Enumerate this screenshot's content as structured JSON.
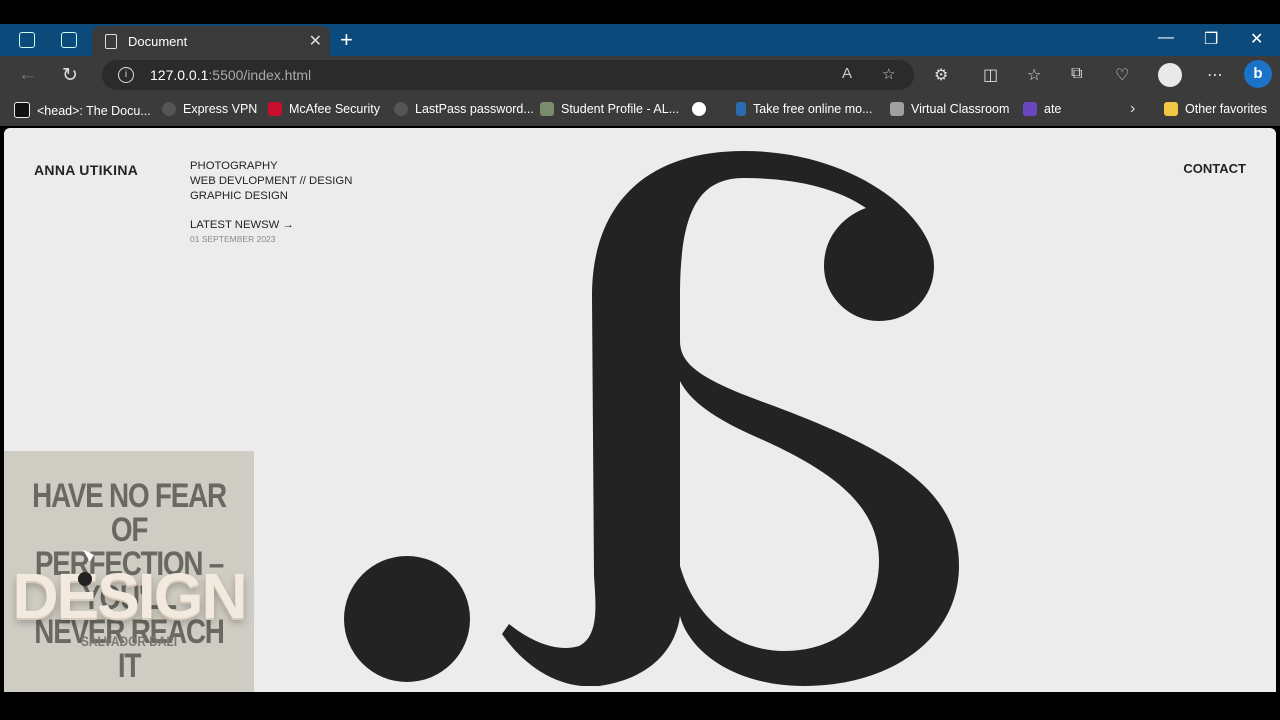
{
  "browser": {
    "tab_title": "Document",
    "url_host": "127.0.0.1",
    "url_rest": ":5500/index.html",
    "bookmarks": [
      {
        "label": "<head>: The Docu...",
        "color": "#111111"
      },
      {
        "label": "Express VPN",
        "color": "#444444"
      },
      {
        "label": "McAfee Security",
        "color": "#c8102e"
      },
      {
        "label": "LastPass password...",
        "color": "#444444"
      },
      {
        "label": "Student Profile - AL...",
        "color": "#7a8c6e"
      },
      {
        "label": "",
        "color": "#ffffff"
      },
      {
        "label": "Take free online mo...",
        "color": "#2b6cb0"
      },
      {
        "label": "Virtual Classroom",
        "color": "#a0a0a0"
      },
      {
        "label": "ate",
        "color": "#6b46c1"
      }
    ],
    "other_favorites": "Other favorites"
  },
  "page": {
    "brand": "ANNA UTIKINA",
    "menu": [
      "PHOTOGRAPHY",
      "WEB DEVLOPMENT // DESIGN",
      "GRAPHIC DESIGN"
    ],
    "news_label": "LATEST NEWSW →",
    "news_date": "01 SEPTEMBER 2023",
    "contact": "CONTACT",
    "card": {
      "quote_line1": "HAVE NO FEAR OF",
      "quote_line2": "PERFECTION – YOU'LL",
      "quote_line3": "NEVER REACH IT",
      "design_word": "DESIGN",
      "author": "SALVADOR DALI"
    }
  }
}
